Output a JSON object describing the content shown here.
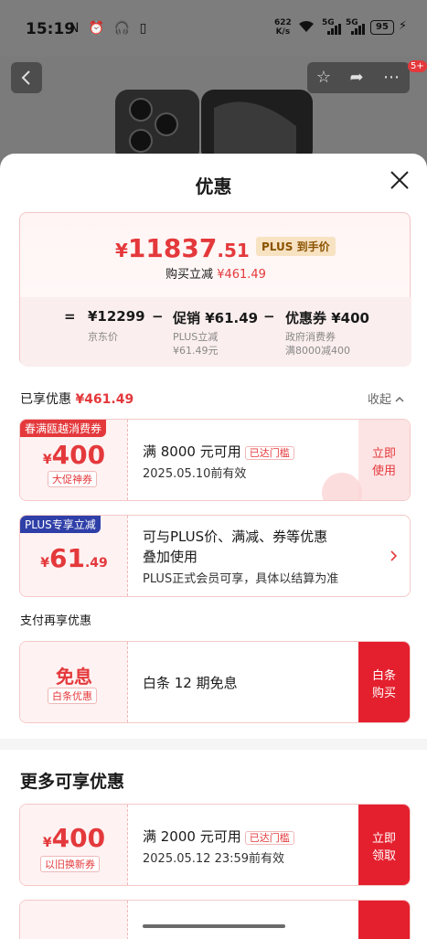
{
  "status": {
    "time": "15:19",
    "left_icons": "N ⏰ 🎧 ▯",
    "speed_top": "622",
    "speed_bottom": "K/s",
    "sig1": "5G",
    "sig2": "5G",
    "battery": "95"
  },
  "header": {
    "back_icon": "chevron-left-icon",
    "badge": "5+"
  },
  "sheet": {
    "title": "优惠"
  },
  "price": {
    "yen": "¥",
    "integer": "11837",
    "decimal": ".51",
    "plus_tag": "PLUS 到手价",
    "reduce_prefix": "购买立减",
    "reduce_amount": "¥461.49"
  },
  "calc": {
    "eq": "=",
    "base_value": "¥12299",
    "base_label": "京东价",
    "minus1": "−",
    "promo_value": "促销 ¥61.49",
    "promo_label1": "PLUS立减",
    "promo_label2": "¥61.49元",
    "minus2": "−",
    "coupon_value": "优惠券 ¥400",
    "coupon_label1": "政府消费券",
    "coupon_label2": "满8000减400"
  },
  "enjoyed": {
    "label": "已享优惠",
    "amount": "¥461.49",
    "collapse": "收起"
  },
  "coupons": [
    {
      "corner": "春满瓯越消费券",
      "yen": "¥",
      "amount": "400",
      "tag": "大促神券",
      "condition": "满 8000 元可用",
      "reached": "已达门槛",
      "date": "2025.05.10前有效",
      "action_line1": "立即",
      "action_line2": "使用"
    },
    {
      "corner": "PLUS专享立减",
      "yen": "¥",
      "amount": "61",
      "decimal": ".49",
      "line1": "可与PLUS价、满减、券等优惠",
      "line2": "叠加使用",
      "line3": "PLUS正式会员可享，具体以结算为准"
    }
  ],
  "pay": {
    "title": "支付再享优惠",
    "main": "免息",
    "tag": "白条优惠",
    "desc": "白条 12 期免息",
    "action_line1": "白条",
    "action_line2": "购买"
  },
  "more": {
    "title": "更多可享优惠",
    "coupon": {
      "yen": "¥",
      "amount": "400",
      "tag": "以旧换新券",
      "condition": "满 2000 元可用",
      "reached": "已达门槛",
      "date": "2025.05.12 23:59前有效",
      "action_line1": "立即",
      "action_line2": "领取"
    }
  },
  "colors": {
    "accent": "#e4393c",
    "action_red": "#e4202e",
    "plus_blue": "#2f3fa8"
  }
}
